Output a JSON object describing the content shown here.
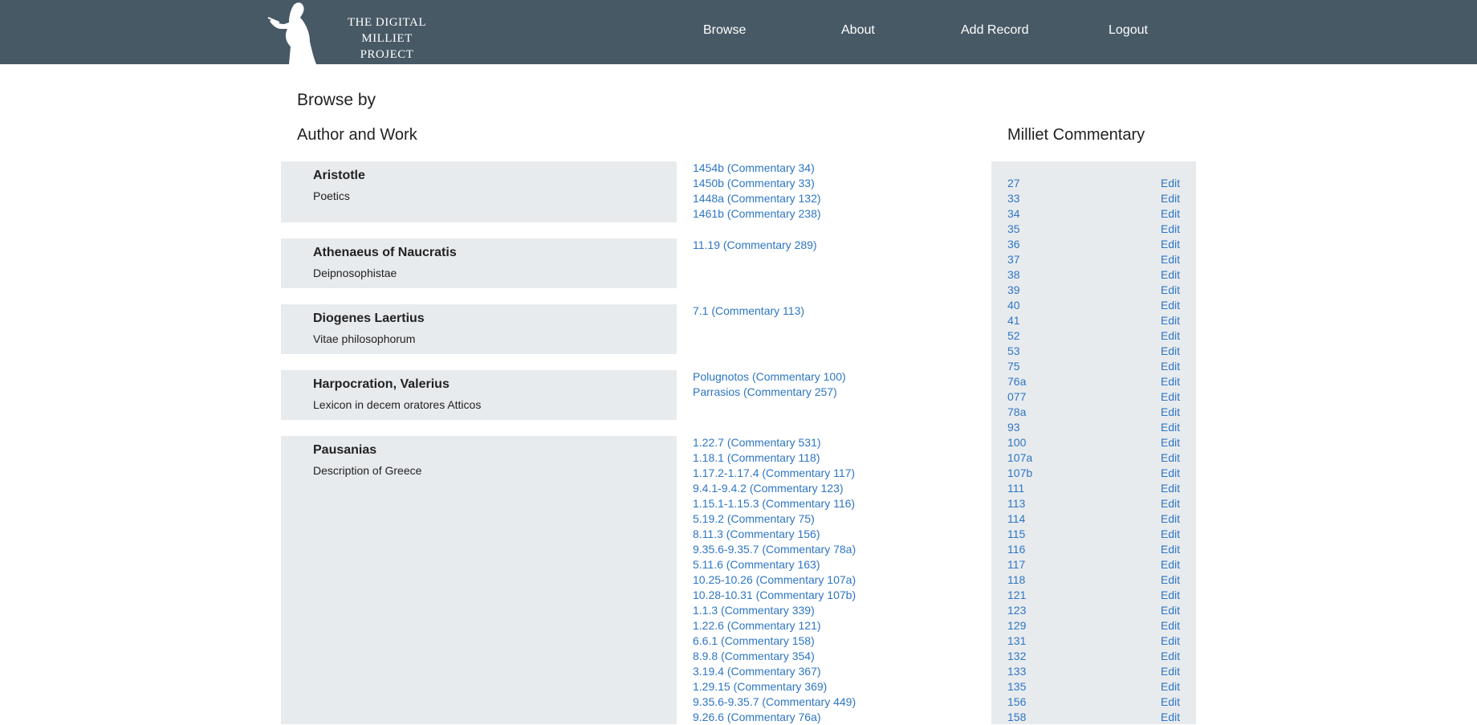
{
  "header": {
    "logo_line1": "THE DIGITAL MILLIET",
    "logo_line2": "PROJECT",
    "nav": [
      "Browse",
      "About",
      "Add Record",
      "Logout"
    ]
  },
  "page": {
    "title": "Browse by",
    "section_author": "Author and Work",
    "section_commentary": "Milliet Commentary"
  },
  "authors": [
    {
      "name": "Aristotle",
      "work": "Poetics",
      "refs": [
        "1454b (Commentary 34)",
        "1450b (Commentary 33)",
        "1448a (Commentary 132)",
        "1461b (Commentary 238)"
      ]
    },
    {
      "name": "Athenaeus of Naucratis",
      "work": "Deipnosophistae",
      "refs": [
        "11.19 (Commentary 289)"
      ]
    },
    {
      "name": "Diogenes Laertius",
      "work": "Vitae philosophorum",
      "refs": [
        "7.1 (Commentary 113)"
      ]
    },
    {
      "name": "Harpocration, Valerius",
      "work": "Lexicon in decem oratores Atticos",
      "refs": [
        "Polugnotos (Commentary 100)",
        "Parrasios (Commentary 257)"
      ]
    },
    {
      "name": "Pausanias",
      "work": "Description of Greece",
      "refs": [
        "1.22.7 (Commentary 531)",
        "1.18.1 (Commentary 118)",
        "1.17.2-1.17.4 (Commentary 117)",
        "9.4.1-9.4.2 (Commentary 123)",
        "1.15.1-1.15.3 (Commentary 116)",
        "5.19.2 (Commentary 75)",
        "8.11.3 (Commentary 156)",
        "9.35.6-9.35.7 (Commentary 78a)",
        "5.11.6 (Commentary 163)",
        "10.25-10.26 (Commentary 107a)",
        "10.28-10.31 (Commentary 107b)",
        "1.1.3 (Commentary 339)",
        "1.22.6 (Commentary 121)",
        "6.6.1 (Commentary 158)",
        "8.9.8 (Commentary 354)",
        "3.19.4 (Commentary 367)",
        "1.29.15 (Commentary 369)",
        "9.35.6-9.35.7 (Commentary 449)",
        "9.26.6 (Commentary 76a)"
      ]
    }
  ],
  "commentaries": {
    "edit_label": "Edit",
    "items": [
      "27",
      "33",
      "34",
      "35",
      "36",
      "37",
      "38",
      "39",
      "40",
      "41",
      "52",
      "53",
      "75",
      "76a",
      "077",
      "78a",
      "93",
      "100",
      "107a",
      "107b",
      "111",
      "113",
      "114",
      "115",
      "116",
      "117",
      "118",
      "121",
      "123",
      "129",
      "131",
      "132",
      "133",
      "135",
      "156",
      "158"
    ]
  }
}
